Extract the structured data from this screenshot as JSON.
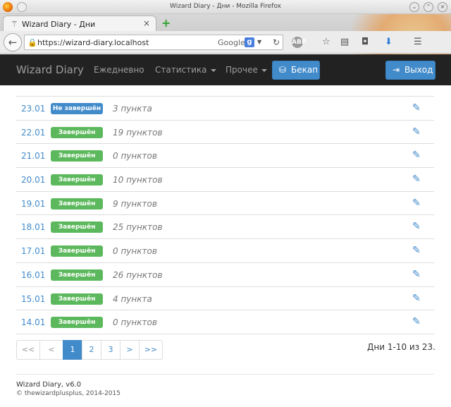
{
  "window": {
    "title": "Wizard Diary - Дни - Mozilla Firefox"
  },
  "tab": {
    "label": "Wizard Diary - Дни",
    "close": "×",
    "new_tab": "+"
  },
  "urlbar": {
    "url": "https://wizard-diary.localhost",
    "search_engine": "Google",
    "search_engine_badge": "g"
  },
  "toolbar_icons": [
    "back-arrow-icon",
    "lock-icon",
    "reload-icon",
    "adblock-icon",
    "bookmark-star-icon",
    "reader-icon",
    "pocket-icon",
    "download-icon",
    "menu-icon"
  ],
  "app": {
    "brand": "Wizard Diary",
    "nav": [
      {
        "label": "Ежедневно",
        "has_caret": false
      },
      {
        "label": "Статистика",
        "has_caret": true
      },
      {
        "label": "Прочее",
        "has_caret": true
      }
    ],
    "backup_label": "Бекап",
    "logout_label": "Выход",
    "colors": {
      "navbar": "#222222",
      "primary": "#428bca",
      "success": "#5cb85c",
      "link": "#428bca"
    }
  },
  "days": [
    {
      "date": "23.01",
      "status": "Не завершён",
      "status_type": "primary",
      "points": "3 пункта"
    },
    {
      "date": "22.01",
      "status": "Завершён",
      "status_type": "success",
      "points": "19 пунктов"
    },
    {
      "date": "21.01",
      "status": "Завершён",
      "status_type": "success",
      "points": "0 пунктов"
    },
    {
      "date": "20.01",
      "status": "Завершён",
      "status_type": "success",
      "points": "10 пунктов"
    },
    {
      "date": "19.01",
      "status": "Завершён",
      "status_type": "success",
      "points": "9 пунктов"
    },
    {
      "date": "18.01",
      "status": "Завершён",
      "status_type": "success",
      "points": "25 пунктов"
    },
    {
      "date": "17.01",
      "status": "Завершён",
      "status_type": "success",
      "points": "0 пунктов"
    },
    {
      "date": "16.01",
      "status": "Завершён",
      "status_type": "success",
      "points": "26 пунктов"
    },
    {
      "date": "15.01",
      "status": "Завершён",
      "status_type": "success",
      "points": "4 пункта"
    },
    {
      "date": "14.01",
      "status": "Завершён",
      "status_type": "success",
      "points": "0 пунктов"
    }
  ],
  "pagination": {
    "items": [
      {
        "label": "<<",
        "state": "disabled"
      },
      {
        "label": "<",
        "state": "disabled"
      },
      {
        "label": "1",
        "state": "active"
      },
      {
        "label": "2",
        "state": "normal"
      },
      {
        "label": "3",
        "state": "normal"
      },
      {
        "label": ">",
        "state": "normal"
      },
      {
        "label": ">>",
        "state": "normal"
      }
    ],
    "summary": "Дни 1-10 из 23."
  },
  "footer": {
    "version": "Wizard Diary, v6.0",
    "copyright": "© thewizardplusplus, 2014-2015"
  }
}
